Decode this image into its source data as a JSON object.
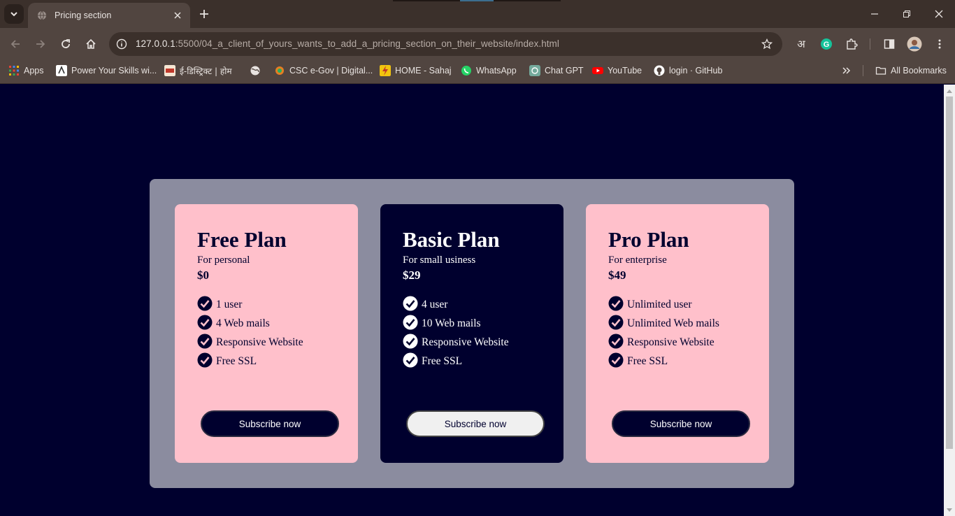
{
  "browser": {
    "tab_title": "Pricing section",
    "url_host": "127.0.0.1",
    "url_path": ":5500/04_a_client_of_yours_wants_to_add_a_pricing_section_on_their_website/index.html",
    "ext_hindi_label": "अ",
    "ext_grammarly_label": "G"
  },
  "bookmarks": [
    {
      "label": "Apps",
      "icon": "apps-grid-icon",
      "color": "#4285f4"
    },
    {
      "label": "Power Your Skills wi...",
      "icon": "power-skills-icon",
      "color": "#ffffff"
    },
    {
      "label": "ई-डिस्ट्रिक्ट | होम",
      "icon": "edistrict-icon",
      "color": "#c0392b"
    },
    {
      "label": "",
      "icon": "globe-icon",
      "color": "#e8e3e0"
    },
    {
      "label": "CSC e-Gov | Digital...",
      "icon": "csc-icon",
      "color": "#e67e22"
    },
    {
      "label": "HOME - Sahaj",
      "icon": "sahaj-icon",
      "color": "#f1c40f"
    },
    {
      "label": "WhatsApp",
      "icon": "whatsapp-icon",
      "color": "#25d366"
    },
    {
      "label": "Chat GPT",
      "icon": "chatgpt-icon",
      "color": "#74aa9c"
    },
    {
      "label": "YouTube",
      "icon": "youtube-icon",
      "color": "#ff0000"
    },
    {
      "label": "login · GitHub",
      "icon": "github-icon",
      "color": "#ffffff"
    }
  ],
  "all_bookmarks_label": "All Bookmarks",
  "plans": [
    {
      "name": "Free Plan",
      "subtitle": "For personal",
      "price": "$0",
      "features": [
        "1 user",
        "4 Web mails",
        "Responsive Website",
        "Free SSL"
      ],
      "button": "Subscribe now",
      "theme": "pink"
    },
    {
      "name": "Basic Plan",
      "subtitle": "For small usiness",
      "price": "$29",
      "features": [
        "4 user",
        "10 Web mails",
        "Responsive Website",
        "Free SSL"
      ],
      "button": "Subscribe now",
      "theme": "dark"
    },
    {
      "name": "Pro Plan",
      "subtitle": "For enterprise",
      "price": "$49",
      "features": [
        "Unlimited user",
        "Unlimited Web mails",
        "Responsive Website",
        "Free SSL"
      ],
      "button": "Subscribe now",
      "theme": "pink"
    }
  ],
  "colors": {
    "page_bg": "#00002e",
    "section_bg": "#8b8c9f",
    "card_pink": "#ffc0cb",
    "card_dark": "#00002e"
  }
}
